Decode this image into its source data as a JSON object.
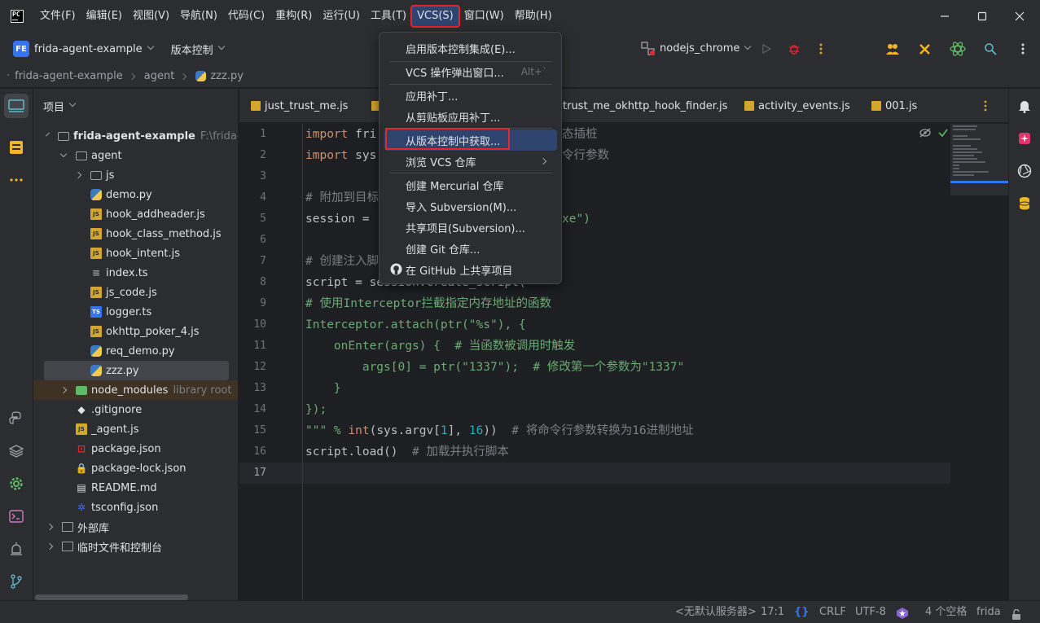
{
  "main_menu": [
    "文件(F)",
    "编辑(E)",
    "视图(V)",
    "导航(N)",
    "代码(C)",
    "重构(R)",
    "运行(U)",
    "工具(T)",
    "VCS(S)",
    "窗口(W)",
    "帮助(H)"
  ],
  "toolbar": {
    "project_badge": "FE",
    "project_name": "frida-agent-example",
    "vcs_widget": "版本控制",
    "run_config": "nodejs_chrome"
  },
  "breadcrumb": [
    "frida-agent-example",
    "agent",
    "zzz.py"
  ],
  "project_panel": {
    "title": "项目",
    "root_label": "frida-agent-example",
    "root_path": "F:\\frida-age",
    "tree": [
      {
        "label": "agent",
        "kind": "folder",
        "depth": 2,
        "state": "expanded"
      },
      {
        "label": "js",
        "kind": "folder-js",
        "depth": 3,
        "state": "collapsed"
      },
      {
        "label": "demo.py",
        "kind": "py",
        "depth": 3
      },
      {
        "label": "hook_addheader.js",
        "kind": "js",
        "depth": 3
      },
      {
        "label": "hook_class_method.js",
        "kind": "js",
        "depth": 3
      },
      {
        "label": "hook_intent.js",
        "kind": "js",
        "depth": 3
      },
      {
        "label": "index.ts",
        "kind": "ts-lines",
        "depth": 3
      },
      {
        "label": "js_code.js",
        "kind": "js",
        "depth": 3
      },
      {
        "label": "logger.ts",
        "kind": "ts",
        "depth": 3
      },
      {
        "label": "okhttp_poker_4.js",
        "kind": "js",
        "depth": 3
      },
      {
        "label": "req_demo.py",
        "kind": "py",
        "depth": 3
      },
      {
        "label": "zzz.py",
        "kind": "py",
        "depth": 3,
        "selected": true
      },
      {
        "label": "node_modules",
        "kind": "folder-green",
        "depth": 2,
        "state": "collapsed",
        "note": "library root"
      },
      {
        "label": ".gitignore",
        "kind": "git",
        "depth": 2
      },
      {
        "label": "_agent.js",
        "kind": "js",
        "depth": 2
      },
      {
        "label": "package.json",
        "kind": "json",
        "depth": 2
      },
      {
        "label": "package-lock.json",
        "kind": "lock",
        "depth": 2
      },
      {
        "label": "README.md",
        "kind": "md",
        "depth": 2
      },
      {
        "label": "tsconfig.json",
        "kind": "gear",
        "depth": 2
      }
    ],
    "external_libs": "外部库",
    "scratches": "临时文件和控制台"
  },
  "tabs": [
    "just_trust_me.js",
    "",
    "trust_me_okhttp_hook_finder.js",
    "activity_events.js",
    "001.js"
  ],
  "code": {
    "line_numbers": [
      "1",
      "2",
      "3",
      "4",
      "5",
      "6",
      "7",
      "8",
      "9",
      "10",
      "11",
      "12",
      "13",
      "14",
      "15",
      "16",
      "17"
    ],
    "l1_kw": "import",
    "l1_rest": " fri",
    "l2_kw": "import",
    "l2_rest": " sys",
    "l4": "# 附加到目标",
    "l5": "session = ",
    "l7": "# 创建注入脚",
    "l8": "script = session.create_script(",
    "l9": "# 使用Interceptor拦截指定内存地址的函数",
    "l10a": "Interceptor.attach(ptr(",
    "l10s": "\"%s\"",
    "l10b": "), {",
    "l11a": "    onEnter(args) {  ",
    "l11c": "# 当函数被调用时触发",
    "l12a": "        args[",
    "l12n": "0",
    "l12b": "] = ptr(",
    "l12s": "\"1337\"",
    "l12c": ");  ",
    "l12m": "# 修改第一个参数为\"1337\"",
    "l13": "    }",
    "l14": "});",
    "l15a": "\"\"\" % ",
    "l15kw": "int",
    "l15b": "(sys.argv[",
    "l15n1": "1",
    "l15c": "], ",
    "l15n2": "16",
    "l15d": "))  ",
    "l15m": "# 将命令行参数转换为16进制地址",
    "l16a": "script.load()  ",
    "l16m": "# 加载并执行脚本",
    "hidden_tail_1": "态插桩",
    "hidden_tail_2": "令行参数",
    "hidden_tail_5": "xe\")"
  },
  "vcs_menu": {
    "items": [
      {
        "label": "启用版本控制集成(E)...",
        "shortcut": ""
      },
      {
        "label": "VCS 操作弹出窗口...",
        "shortcut": "Alt+`"
      },
      {
        "label": "应用补丁...",
        "shortcut": ""
      },
      {
        "label": "从剪贴板应用补丁...",
        "shortcut": ""
      },
      {
        "label": "从版本控制中获取...",
        "shortcut": "",
        "highlighted": true
      },
      {
        "label": "浏览 VCS 仓库",
        "shortcut": "",
        "submenu": true
      },
      {
        "label": "创建 Mercurial 仓库",
        "shortcut": ""
      },
      {
        "label": "导入 Subversion(M)...",
        "shortcut": ""
      },
      {
        "label": "共享项目(Subversion)...",
        "shortcut": ""
      },
      {
        "label": "创建 Git 仓库...",
        "shortcut": ""
      },
      {
        "label": "在 GitHub 上共享项目",
        "shortcut": "",
        "icon": "github-icon"
      }
    ]
  },
  "statusbar": {
    "server": "<无默认服务器>",
    "position": "17:1",
    "line_sep": "CRLF",
    "encoding": "UTF-8",
    "indent": "4 个空格",
    "interpreter": "frida"
  },
  "colors": {
    "accent": "#3574f0",
    "highlight": "#e5262b",
    "selection": "#2e436e"
  }
}
